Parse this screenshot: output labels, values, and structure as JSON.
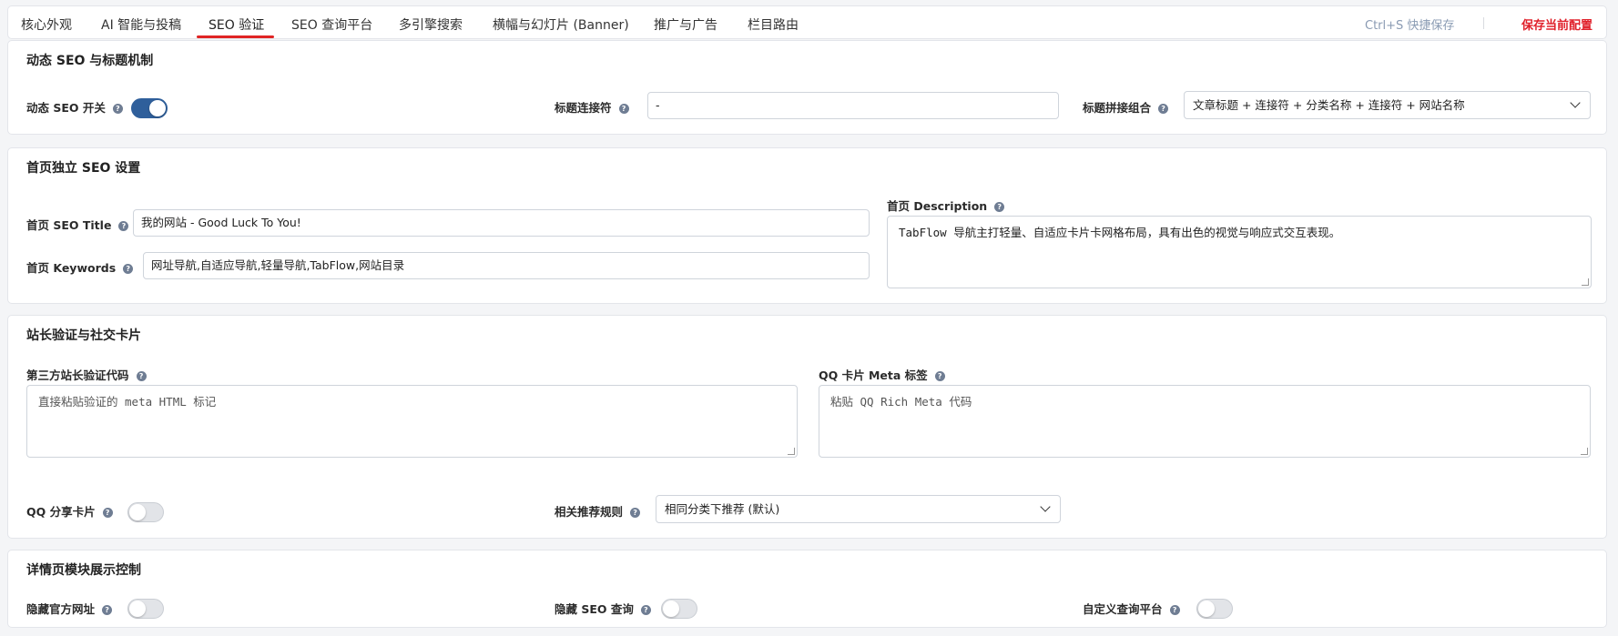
{
  "tabs": [
    {
      "label": "核心外观"
    },
    {
      "label": "AI 智能与投稿"
    },
    {
      "label": "SEO 验证"
    },
    {
      "label": "SEO 查询平台"
    },
    {
      "label": "多引擎搜索"
    },
    {
      "label": "横幅与幻灯片 (Banner)"
    },
    {
      "label": "推广与广告"
    },
    {
      "label": "栏目路由"
    }
  ],
  "active_tab": "SEO 验证",
  "toolbar": {
    "shortcut_hint": "Ctrl+S 快捷保存",
    "save_label": "保存当前配置"
  },
  "help_glyph": "?",
  "section_dynamic": {
    "title": "动态 SEO 与标题机制",
    "seo_switch_label": "动态 SEO 开关",
    "seo_switch_on": true,
    "separator_label": "标题连接符",
    "separator_value": "-",
    "combo_label": "标题拼接组合",
    "combo_value": "文章标题 + 连接符 + 分类名称 + 连接符 + 网站名称"
  },
  "section_home": {
    "title": "首页独立 SEO 设置",
    "seo_title_label": "首页 SEO Title",
    "seo_title_value": "我的网站 - Good Luck To You!",
    "keywords_label": "首页 Keywords",
    "keywords_value": "网址导航,自适应导航,轻量导航,TabFlow,网站目录",
    "description_label": "首页 Description",
    "description_value": "TabFlow 导航主打轻量、自适应卡片卡网格布局，具有出色的视觉与响应式交互表现。"
  },
  "section_verify": {
    "title": "站长验证与社交卡片",
    "verify_label": "第三方站长验证代码",
    "verify_placeholder": "直接粘贴验证的 meta HTML 标记",
    "qq_meta_label": "QQ 卡片 Meta 标签",
    "qq_meta_placeholder": "粘贴 QQ Rich Meta 代码",
    "qq_share_label": "QQ 分享卡片",
    "qq_share_on": false,
    "related_label": "相关推荐规则",
    "related_value": "相同分类下推荐 (默认)"
  },
  "section_detail": {
    "title": "详情页模块展示控制",
    "hide_official_label": "隐藏官方网址",
    "hide_official_on": false,
    "hide_seo_label": "隐藏 SEO 查询",
    "hide_seo_on": false,
    "custom_query_label": "自定义查询平台",
    "custom_query_on": false
  },
  "colors": {
    "accent": "#e02424",
    "toggle_on": "#2f5f9b",
    "save": "#e0202a"
  }
}
